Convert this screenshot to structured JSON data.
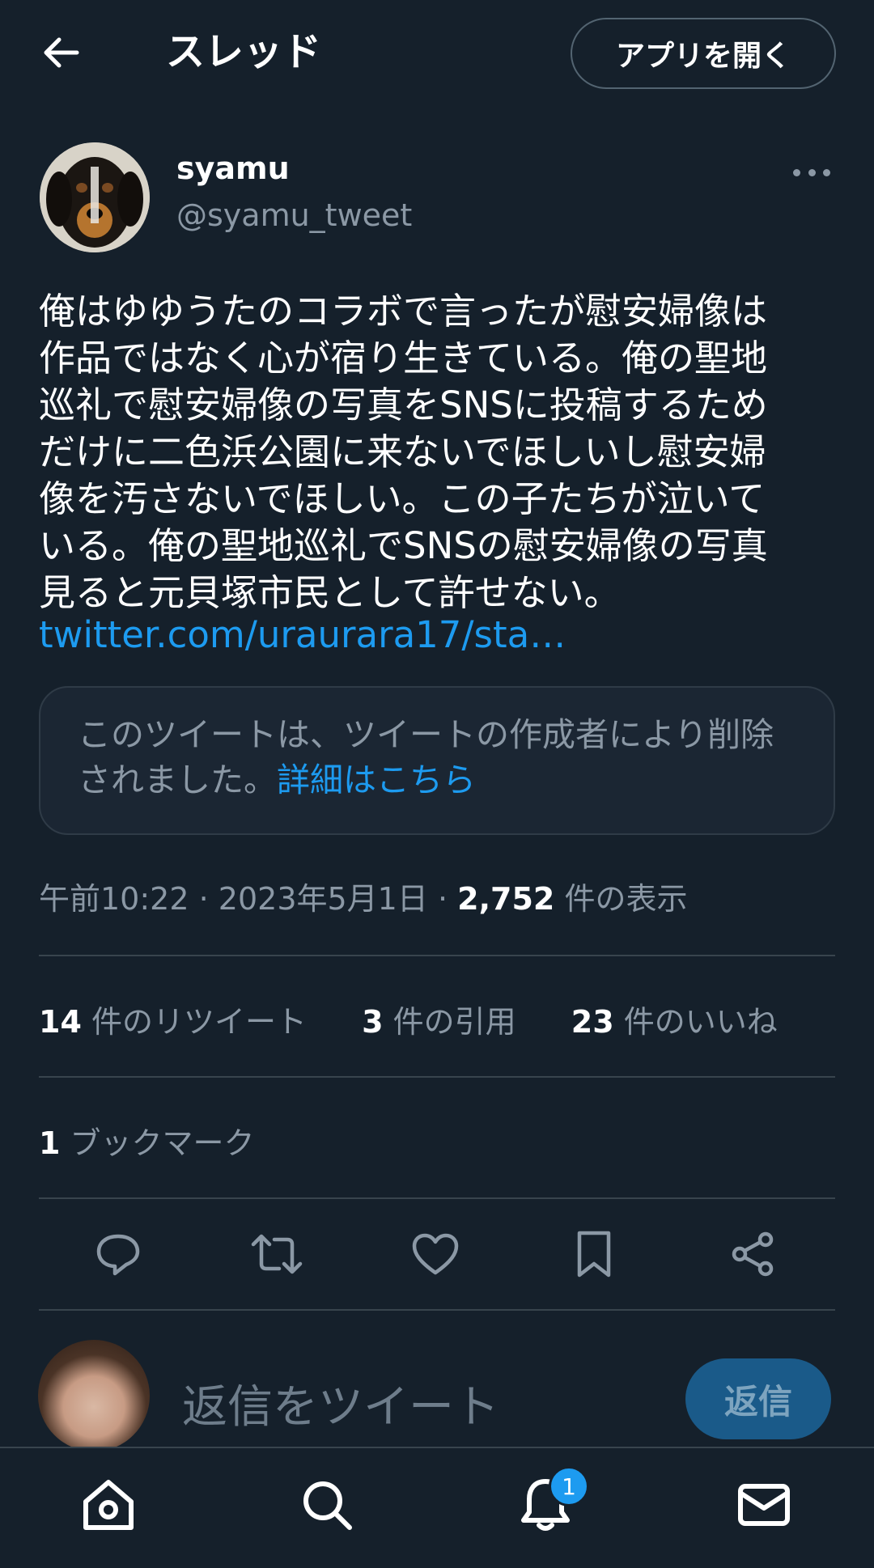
{
  "header": {
    "title": "スレッド",
    "open_app_label": "アプリを開く",
    "back_icon": "arrow-left-icon"
  },
  "tweet": {
    "display_name": "syamu",
    "handle": "@syamu_tweet",
    "text": "俺はゆゆうたのコラボで言ったが慰安婦像は\n作品ではなく心が宿り生きている。俺の聖地\n巡礼で慰安婦像の写真をSNSに投稿するため\nだけに二色浜公園に来ないでほしいし慰安婦\n像を汚さないでほしい。この子たちが泣いて\nいる。俺の聖地巡礼でSNSの慰安婦像の写真\n見ると元貝塚市民として許せない。",
    "link": "twitter.com/uraurara17/sta…",
    "quoted_deleted": {
      "text": "このツイートは、ツイートの作成者により削除\nされました。",
      "link_text": "詳細はこちら"
    },
    "meta": {
      "time": "午前10:22",
      "sep": "·",
      "date": "2023年5月1日",
      "views_count": "2,752",
      "views_label": "件の表示"
    },
    "stats": {
      "retweets_count": "14",
      "retweets_label": "件のリツイート",
      "quotes_count": "3",
      "quotes_label": "件の引用",
      "likes_count": "23",
      "likes_label": "件のいいね",
      "bookmarks_count": "1",
      "bookmarks_label": "ブックマーク"
    }
  },
  "reply": {
    "placeholder": "返信をツイート",
    "button_label": "返信"
  },
  "bottom_nav": {
    "items": [
      "home-icon",
      "search-icon",
      "notifications-icon",
      "messages-icon"
    ],
    "notification_badge": "1"
  },
  "colors": {
    "background": "#15202b",
    "accent": "#1d9bf0",
    "secondary_text": "#8b98a5",
    "divider": "#38444d"
  }
}
